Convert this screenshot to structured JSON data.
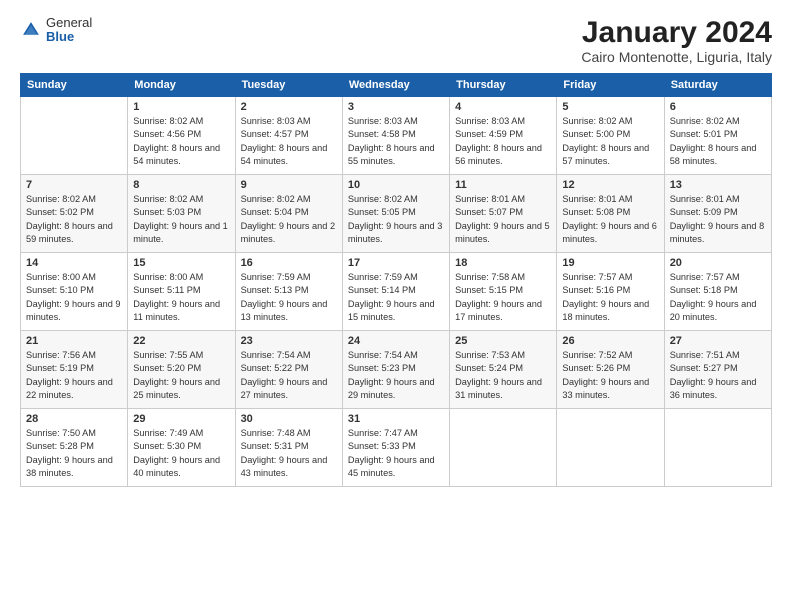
{
  "header": {
    "logo_general": "General",
    "logo_blue": "Blue",
    "month_title": "January 2024",
    "location": "Cairo Montenotte, Liguria, Italy"
  },
  "weekdays": [
    "Sunday",
    "Monday",
    "Tuesday",
    "Wednesday",
    "Thursday",
    "Friday",
    "Saturday"
  ],
  "weeks": [
    [
      {
        "day": "",
        "sunrise": "",
        "sunset": "",
        "daylight": ""
      },
      {
        "day": "1",
        "sunrise": "Sunrise: 8:02 AM",
        "sunset": "Sunset: 4:56 PM",
        "daylight": "Daylight: 8 hours and 54 minutes."
      },
      {
        "day": "2",
        "sunrise": "Sunrise: 8:03 AM",
        "sunset": "Sunset: 4:57 PM",
        "daylight": "Daylight: 8 hours and 54 minutes."
      },
      {
        "day": "3",
        "sunrise": "Sunrise: 8:03 AM",
        "sunset": "Sunset: 4:58 PM",
        "daylight": "Daylight: 8 hours and 55 minutes."
      },
      {
        "day": "4",
        "sunrise": "Sunrise: 8:03 AM",
        "sunset": "Sunset: 4:59 PM",
        "daylight": "Daylight: 8 hours and 56 minutes."
      },
      {
        "day": "5",
        "sunrise": "Sunrise: 8:02 AM",
        "sunset": "Sunset: 5:00 PM",
        "daylight": "Daylight: 8 hours and 57 minutes."
      },
      {
        "day": "6",
        "sunrise": "Sunrise: 8:02 AM",
        "sunset": "Sunset: 5:01 PM",
        "daylight": "Daylight: 8 hours and 58 minutes."
      }
    ],
    [
      {
        "day": "7",
        "sunrise": "Sunrise: 8:02 AM",
        "sunset": "Sunset: 5:02 PM",
        "daylight": "Daylight: 8 hours and 59 minutes."
      },
      {
        "day": "8",
        "sunrise": "Sunrise: 8:02 AM",
        "sunset": "Sunset: 5:03 PM",
        "daylight": "Daylight: 9 hours and 1 minute."
      },
      {
        "day": "9",
        "sunrise": "Sunrise: 8:02 AM",
        "sunset": "Sunset: 5:04 PM",
        "daylight": "Daylight: 9 hours and 2 minutes."
      },
      {
        "day": "10",
        "sunrise": "Sunrise: 8:02 AM",
        "sunset": "Sunset: 5:05 PM",
        "daylight": "Daylight: 9 hours and 3 minutes."
      },
      {
        "day": "11",
        "sunrise": "Sunrise: 8:01 AM",
        "sunset": "Sunset: 5:07 PM",
        "daylight": "Daylight: 9 hours and 5 minutes."
      },
      {
        "day": "12",
        "sunrise": "Sunrise: 8:01 AM",
        "sunset": "Sunset: 5:08 PM",
        "daylight": "Daylight: 9 hours and 6 minutes."
      },
      {
        "day": "13",
        "sunrise": "Sunrise: 8:01 AM",
        "sunset": "Sunset: 5:09 PM",
        "daylight": "Daylight: 9 hours and 8 minutes."
      }
    ],
    [
      {
        "day": "14",
        "sunrise": "Sunrise: 8:00 AM",
        "sunset": "Sunset: 5:10 PM",
        "daylight": "Daylight: 9 hours and 9 minutes."
      },
      {
        "day": "15",
        "sunrise": "Sunrise: 8:00 AM",
        "sunset": "Sunset: 5:11 PM",
        "daylight": "Daylight: 9 hours and 11 minutes."
      },
      {
        "day": "16",
        "sunrise": "Sunrise: 7:59 AM",
        "sunset": "Sunset: 5:13 PM",
        "daylight": "Daylight: 9 hours and 13 minutes."
      },
      {
        "day": "17",
        "sunrise": "Sunrise: 7:59 AM",
        "sunset": "Sunset: 5:14 PM",
        "daylight": "Daylight: 9 hours and 15 minutes."
      },
      {
        "day": "18",
        "sunrise": "Sunrise: 7:58 AM",
        "sunset": "Sunset: 5:15 PM",
        "daylight": "Daylight: 9 hours and 17 minutes."
      },
      {
        "day": "19",
        "sunrise": "Sunrise: 7:57 AM",
        "sunset": "Sunset: 5:16 PM",
        "daylight": "Daylight: 9 hours and 18 minutes."
      },
      {
        "day": "20",
        "sunrise": "Sunrise: 7:57 AM",
        "sunset": "Sunset: 5:18 PM",
        "daylight": "Daylight: 9 hours and 20 minutes."
      }
    ],
    [
      {
        "day": "21",
        "sunrise": "Sunrise: 7:56 AM",
        "sunset": "Sunset: 5:19 PM",
        "daylight": "Daylight: 9 hours and 22 minutes."
      },
      {
        "day": "22",
        "sunrise": "Sunrise: 7:55 AM",
        "sunset": "Sunset: 5:20 PM",
        "daylight": "Daylight: 9 hours and 25 minutes."
      },
      {
        "day": "23",
        "sunrise": "Sunrise: 7:54 AM",
        "sunset": "Sunset: 5:22 PM",
        "daylight": "Daylight: 9 hours and 27 minutes."
      },
      {
        "day": "24",
        "sunrise": "Sunrise: 7:54 AM",
        "sunset": "Sunset: 5:23 PM",
        "daylight": "Daylight: 9 hours and 29 minutes."
      },
      {
        "day": "25",
        "sunrise": "Sunrise: 7:53 AM",
        "sunset": "Sunset: 5:24 PM",
        "daylight": "Daylight: 9 hours and 31 minutes."
      },
      {
        "day": "26",
        "sunrise": "Sunrise: 7:52 AM",
        "sunset": "Sunset: 5:26 PM",
        "daylight": "Daylight: 9 hours and 33 minutes."
      },
      {
        "day": "27",
        "sunrise": "Sunrise: 7:51 AM",
        "sunset": "Sunset: 5:27 PM",
        "daylight": "Daylight: 9 hours and 36 minutes."
      }
    ],
    [
      {
        "day": "28",
        "sunrise": "Sunrise: 7:50 AM",
        "sunset": "Sunset: 5:28 PM",
        "daylight": "Daylight: 9 hours and 38 minutes."
      },
      {
        "day": "29",
        "sunrise": "Sunrise: 7:49 AM",
        "sunset": "Sunset: 5:30 PM",
        "daylight": "Daylight: 9 hours and 40 minutes."
      },
      {
        "day": "30",
        "sunrise": "Sunrise: 7:48 AM",
        "sunset": "Sunset: 5:31 PM",
        "daylight": "Daylight: 9 hours and 43 minutes."
      },
      {
        "day": "31",
        "sunrise": "Sunrise: 7:47 AM",
        "sunset": "Sunset: 5:33 PM",
        "daylight": "Daylight: 9 hours and 45 minutes."
      },
      {
        "day": "",
        "sunrise": "",
        "sunset": "",
        "daylight": ""
      },
      {
        "day": "",
        "sunrise": "",
        "sunset": "",
        "daylight": ""
      },
      {
        "day": "",
        "sunrise": "",
        "sunset": "",
        "daylight": ""
      }
    ]
  ]
}
